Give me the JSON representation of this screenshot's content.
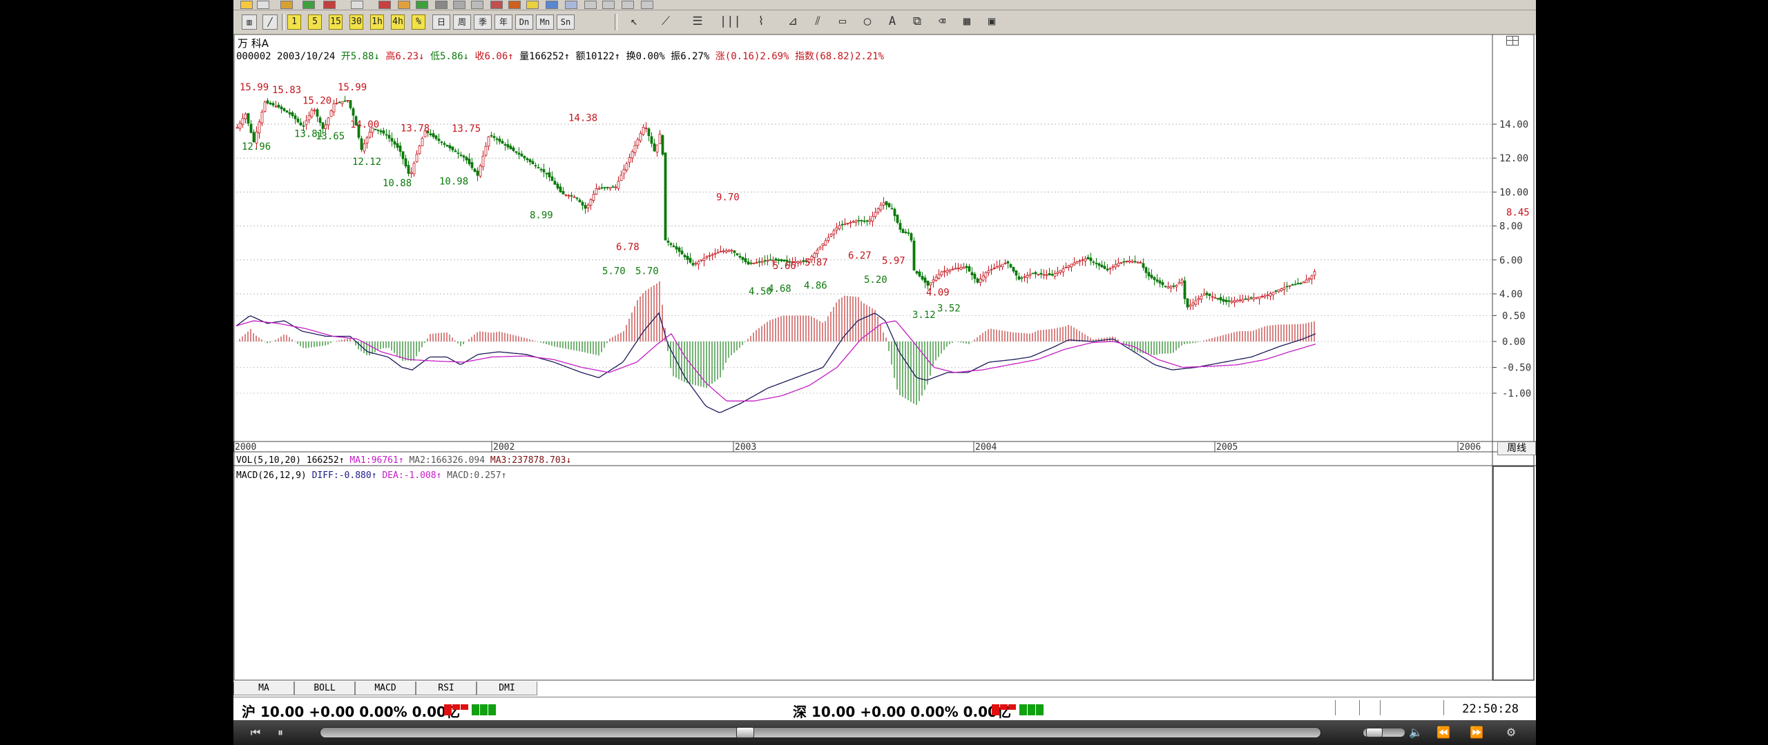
{
  "toolbar": {
    "row2_buttons": [
      "1",
      "5",
      "15",
      "30",
      "1h",
      "4h",
      "%",
      "日",
      "周",
      "季",
      "年",
      "Dn",
      "Mn",
      "Sn"
    ],
    "drawing_tools": [
      "cursor-icon",
      "line-tool-icon",
      "fib-tool-icon",
      "vertical-lines-icon",
      "fan-tool-icon",
      "gann-tool-icon",
      "parallel-tool-icon",
      "rectangle-tool-icon",
      "ellipse-tool-icon",
      "text-tool-icon",
      "copy-icon",
      "eraser-icon",
      "color-palette-icon",
      "save-icon"
    ],
    "text_tool_label": "A"
  },
  "stock": {
    "name": "万  科A",
    "code": "000002",
    "date": "2003/10/24",
    "open_label": "开",
    "open": "5.88",
    "high_label": "高",
    "high": "6.23",
    "low_label": "低",
    "low": "5.86",
    "close_label": "收",
    "close": "6.06",
    "vol_label": "量",
    "vol": "166252",
    "amt_label": "额",
    "amt": "10122",
    "turn_label": "换",
    "turn": "0.00%",
    "amp_label": "振",
    "amp": "6.27%",
    "chg_label": "涨",
    "chg": "(0.16)2.69%",
    "idx_label": "指数",
    "idx": "(68.82)2.21%"
  },
  "period_label": "周线",
  "right_corner_icon": "layout-icon",
  "price_axis": {
    "labels": [
      "14.00",
      "12.00",
      "10.00",
      "8.00",
      "6.00",
      "4.00"
    ],
    "current": "8.45"
  },
  "time_axis": [
    "2000",
    "2002",
    "2003",
    "2004",
    "2005",
    "2006"
  ],
  "chart_data": {
    "type": "candlestick-weekly",
    "ticker": "000002",
    "peak_trough_labels": [
      {
        "text": "15.99",
        "kind": "high"
      },
      {
        "text": "15.83",
        "kind": "high"
      },
      {
        "text": "15.20",
        "kind": "high"
      },
      {
        "text": "15.99",
        "kind": "high"
      },
      {
        "text": "12.96",
        "kind": "low"
      },
      {
        "text": "13.81",
        "kind": "low"
      },
      {
        "text": "13.65",
        "kind": "low"
      },
      {
        "text": "14.00",
        "kind": "high"
      },
      {
        "text": "12.12",
        "kind": "low"
      },
      {
        "text": "13.78",
        "kind": "high"
      },
      {
        "text": "10.88",
        "kind": "low"
      },
      {
        "text": "13.75",
        "kind": "high"
      },
      {
        "text": "10.98",
        "kind": "low"
      },
      {
        "text": "8.99",
        "kind": "low"
      },
      {
        "text": "14.38",
        "kind": "high"
      },
      {
        "text": "6.78",
        "kind": "high"
      },
      {
        "text": "5.70",
        "kind": "low"
      },
      {
        "text": "5.70",
        "kind": "low"
      },
      {
        "text": "9.70",
        "kind": "high"
      },
      {
        "text": "4.50",
        "kind": "low"
      },
      {
        "text": "5.66",
        "kind": "high"
      },
      {
        "text": "4.68",
        "kind": "low"
      },
      {
        "text": "5.87",
        "kind": "high"
      },
      {
        "text": "4.86",
        "kind": "low"
      },
      {
        "text": "6.27",
        "kind": "high"
      },
      {
        "text": "5.97",
        "kind": "high"
      },
      {
        "text": "5.20",
        "kind": "low"
      },
      {
        "text": "3.12",
        "kind": "low"
      },
      {
        "text": "4.09",
        "kind": "high"
      },
      {
        "text": "3.52",
        "kind": "low"
      }
    ],
    "price_path": [
      [
        0,
        13.8
      ],
      [
        12,
        14.6
      ],
      [
        24,
        12.96
      ],
      [
        40,
        15.3
      ],
      [
        60,
        15.0
      ],
      [
        80,
        14.5
      ],
      [
        95,
        13.81
      ],
      [
        110,
        15.0
      ],
      [
        125,
        13.65
      ],
      [
        140,
        15.2
      ],
      [
        160,
        15.4
      ],
      [
        170,
        14.3
      ],
      [
        180,
        12.5
      ],
      [
        195,
        13.8
      ],
      [
        215,
        13.4
      ],
      [
        235,
        12.5
      ],
      [
        250,
        10.88
      ],
      [
        262,
        12.5
      ],
      [
        272,
        13.6
      ],
      [
        300,
        12.8
      ],
      [
        330,
        12.0
      ],
      [
        348,
        10.98
      ],
      [
        365,
        13.4
      ],
      [
        390,
        12.7
      ],
      [
        420,
        11.9
      ],
      [
        450,
        11.0
      ],
      [
        470,
        9.9
      ],
      [
        490,
        9.7
      ],
      [
        505,
        8.99
      ],
      [
        520,
        10.2
      ],
      [
        548,
        10.3
      ],
      [
        570,
        12.2
      ],
      [
        590,
        14.0
      ],
      [
        605,
        12.3
      ],
      [
        615,
        13.9
      ],
      [
        619,
        7.2
      ],
      [
        640,
        6.5
      ],
      [
        660,
        5.7
      ],
      [
        680,
        6.2
      ],
      [
        700,
        6.5
      ],
      [
        715,
        6.6
      ],
      [
        740,
        5.75
      ],
      [
        770,
        6.0
      ],
      [
        800,
        5.9
      ],
      [
        825,
        5.9
      ],
      [
        845,
        6.8
      ],
      [
        870,
        8.0
      ],
      [
        895,
        8.3
      ],
      [
        915,
        8.3
      ],
      [
        935,
        9.4
      ],
      [
        948,
        9.0
      ],
      [
        962,
        7.6
      ],
      [
        975,
        7.6
      ],
      [
        980,
        5.4
      ],
      [
        1000,
        4.5
      ],
      [
        1020,
        5.3
      ],
      [
        1040,
        5.5
      ],
      [
        1055,
        5.6
      ],
      [
        1072,
        4.68
      ],
      [
        1085,
        5.3
      ],
      [
        1100,
        5.6
      ],
      [
        1115,
        5.87
      ],
      [
        1132,
        4.86
      ],
      [
        1150,
        5.2
      ],
      [
        1180,
        5.1
      ],
      [
        1210,
        5.8
      ],
      [
        1230,
        6.1
      ],
      [
        1240,
        5.85
      ],
      [
        1260,
        5.4
      ],
      [
        1275,
        5.8
      ],
      [
        1290,
        5.95
      ],
      [
        1308,
        5.85
      ],
      [
        1318,
        5.1
      ],
      [
        1345,
        4.4
      ],
      [
        1360,
        4.5
      ],
      [
        1370,
        4.9
      ],
      [
        1373,
        3.12
      ],
      [
        1385,
        3.5
      ],
      [
        1400,
        4.0
      ],
      [
        1415,
        3.8
      ],
      [
        1430,
        3.52
      ],
      [
        1445,
        3.6
      ],
      [
        1470,
        3.75
      ],
      [
        1490,
        3.9
      ],
      [
        1505,
        4.2
      ],
      [
        1525,
        4.5
      ],
      [
        1540,
        4.6
      ],
      [
        1555,
        5.0
      ],
      [
        1563,
        5.5
      ]
    ],
    "volume_header": {
      "name": "VOL(5,10,20)",
      "value": "166252",
      "ma1_label": "MA1:",
      "ma1": "96761",
      "ma2_label": "MA2:",
      "ma2": "166326.094",
      "ma3_label": "MA3:",
      "ma3": "237878.703"
    },
    "macd_header": {
      "name": "MACD(26,12,9)",
      "diff_label": "DIFF:",
      "diff": "-0.880",
      "dea_label": "DEA:",
      "dea": "-1.008",
      "macd_label": "MACD:",
      "macd": "0.257"
    },
    "macd_axis": [
      "0.50",
      "0.00",
      "-0.50",
      "-1.00"
    ],
    "diff_path": [
      [
        0,
        0.3
      ],
      [
        20,
        0.5
      ],
      [
        45,
        0.35
      ],
      [
        70,
        0.4
      ],
      [
        95,
        0.2
      ],
      [
        130,
        0.1
      ],
      [
        165,
        0.1
      ],
      [
        190,
        -0.2
      ],
      [
        220,
        -0.3
      ],
      [
        240,
        -0.5
      ],
      [
        255,
        -0.55
      ],
      [
        280,
        -0.3
      ],
      [
        305,
        -0.3
      ],
      [
        325,
        -0.45
      ],
      [
        350,
        -0.25
      ],
      [
        380,
        -0.2
      ],
      [
        420,
        -0.25
      ],
      [
        460,
        -0.4
      ],
      [
        500,
        -0.6
      ],
      [
        525,
        -0.7
      ],
      [
        560,
        -0.4
      ],
      [
        590,
        0.2
      ],
      [
        612,
        0.55
      ],
      [
        625,
        -0.05
      ],
      [
        650,
        -0.7
      ],
      [
        680,
        -1.25
      ],
      [
        700,
        -1.38
      ],
      [
        730,
        -1.2
      ],
      [
        770,
        -0.9
      ],
      [
        810,
        -0.7
      ],
      [
        850,
        -0.5
      ],
      [
        880,
        0.1
      ],
      [
        900,
        0.4
      ],
      [
        925,
        0.55
      ],
      [
        940,
        0.4
      ],
      [
        960,
        -0.2
      ],
      [
        985,
        -0.7
      ],
      [
        1000,
        -0.75
      ],
      [
        1030,
        -0.6
      ],
      [
        1060,
        -0.6
      ],
      [
        1090,
        -0.4
      ],
      [
        1125,
        -0.35
      ],
      [
        1150,
        -0.3
      ],
      [
        1185,
        -0.1
      ],
      [
        1205,
        0.03
      ],
      [
        1240,
        0.0
      ],
      [
        1270,
        0.05
      ],
      [
        1300,
        -0.2
      ],
      [
        1330,
        -0.45
      ],
      [
        1355,
        -0.55
      ],
      [
        1390,
        -0.5
      ],
      [
        1430,
        -0.4
      ],
      [
        1470,
        -0.3
      ],
      [
        1510,
        -0.1
      ],
      [
        1545,
        0.05
      ],
      [
        1563,
        0.15
      ]
    ],
    "dea_path": [
      [
        0,
        0.3
      ],
      [
        25,
        0.4
      ],
      [
        60,
        0.35
      ],
      [
        100,
        0.25
      ],
      [
        140,
        0.1
      ],
      [
        175,
        0.05
      ],
      [
        210,
        -0.2
      ],
      [
        250,
        -0.35
      ],
      [
        290,
        -0.38
      ],
      [
        330,
        -0.4
      ],
      [
        370,
        -0.3
      ],
      [
        420,
        -0.28
      ],
      [
        460,
        -0.35
      ],
      [
        500,
        -0.5
      ],
      [
        540,
        -0.6
      ],
      [
        580,
        -0.4
      ],
      [
        610,
        -0.05
      ],
      [
        630,
        0.15
      ],
      [
        650,
        -0.3
      ],
      [
        680,
        -0.8
      ],
      [
        710,
        -1.15
      ],
      [
        750,
        -1.15
      ],
      [
        790,
        -1.05
      ],
      [
        830,
        -0.85
      ],
      [
        870,
        -0.5
      ],
      [
        905,
        0.05
      ],
      [
        935,
        0.35
      ],
      [
        955,
        0.4
      ],
      [
        980,
        0.0
      ],
      [
        1010,
        -0.5
      ],
      [
        1040,
        -0.6
      ],
      [
        1080,
        -0.55
      ],
      [
        1120,
        -0.45
      ],
      [
        1160,
        -0.35
      ],
      [
        1200,
        -0.15
      ],
      [
        1240,
        -0.02
      ],
      [
        1270,
        0.0
      ],
      [
        1300,
        -0.1
      ],
      [
        1335,
        -0.35
      ],
      [
        1370,
        -0.5
      ],
      [
        1410,
        -0.48
      ],
      [
        1450,
        -0.45
      ],
      [
        1490,
        -0.35
      ],
      [
        1525,
        -0.2
      ],
      [
        1563,
        -0.05
      ]
    ]
  },
  "indicator_tabs": [
    "MA",
    "BOLL",
    "MACD",
    "RSI",
    "DMI"
  ],
  "status": {
    "sh_label": "沪",
    "sh_value": "10.00 +0.00 0.00% 0.00亿",
    "sz_label": "深",
    "sz_value": "10.00 +0.00 0.00% 0.00亿",
    "time": "22:50:28"
  },
  "player": {
    "buttons": [
      "prev-icon",
      "pause-icon",
      "volume-icon",
      "rewind-icon",
      "fast-forward-icon",
      "settings-icon"
    ]
  }
}
